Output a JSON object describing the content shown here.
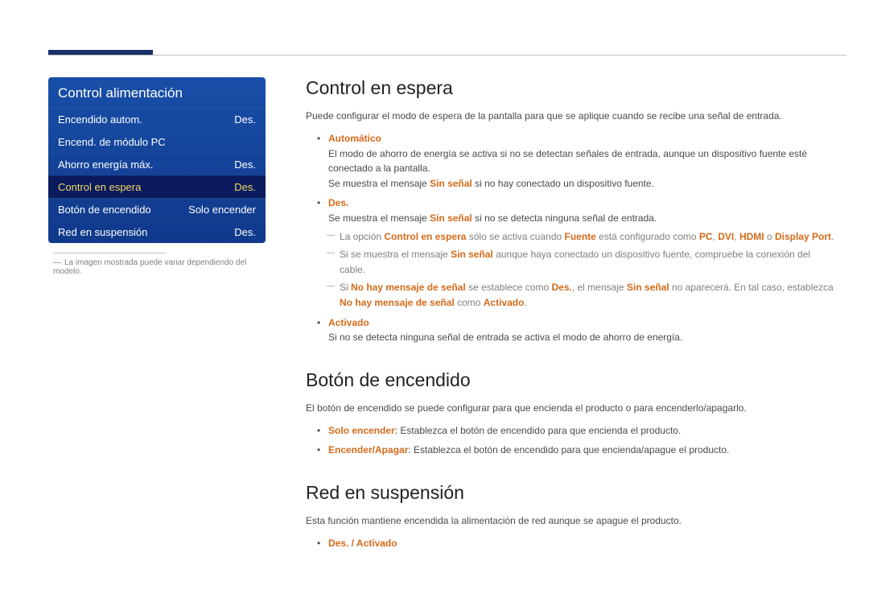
{
  "osd": {
    "title": "Control alimentación",
    "items": [
      {
        "label": "Encendido autom.",
        "value": "Des."
      },
      {
        "label": "Encend. de módulo PC",
        "value": ""
      },
      {
        "label": "Ahorro energía máx.",
        "value": "Des."
      },
      {
        "label": "Control en espera",
        "value": "Des.",
        "selected": true
      },
      {
        "label": "Botón de encendido",
        "value": "Solo encender"
      },
      {
        "label": "Red en suspensión",
        "value": "Des."
      }
    ]
  },
  "sidebar_note_dash": "―",
  "sidebar_note": "La imagen mostrada puede variar dependiendo del modelo.",
  "s1_h": "Control en espera",
  "s1_p": "Puede configurar el modo de espera de la pantalla para que se aplique cuando se recibe una señal de entrada.",
  "s1_b1_head": "Automático",
  "s1_b1_l1": "El modo de ahorro de energía se activa si no se detectan señales de entrada, aunque un dispositivo fuente esté conectado a la pantalla.",
  "s1_b1_l2_a": "Se muestra el mensaje ",
  "s1_b1_l2_hl": "Sin señal",
  "s1_b1_l2_b": " si no hay conectado un dispositivo fuente.",
  "s1_b2_head": "Des.",
  "s1_b2_l1_a": "Se muestra el mensaje ",
  "s1_b2_l1_hl": "Sin señal",
  "s1_b2_l1_b": " si no se detecta ninguna señal de entrada.",
  "s1_s1_a": "La opción ",
  "s1_s1_hl1": "Control en espera",
  "s1_s1_b": " sólo se activa cuando ",
  "s1_s1_hl2": "Fuente",
  "s1_s1_c": " está configurado como ",
  "s1_s1_hl3": "PC",
  "s1_s1_comma1": ", ",
  "s1_s1_hl4": "DVI",
  "s1_s1_comma2": ", ",
  "s1_s1_hl5": "HDMI",
  "s1_s1_d": " o ",
  "s1_s1_hl6": "Display Port",
  "s1_s1_e": ".",
  "s1_s2_a": "Si se muestra el mensaje ",
  "s1_s2_hl": "Sin señal",
  "s1_s2_b": " aunque haya conectado un dispositivo fuente, compruebe la conexión del cable.",
  "s1_s3_a": "Si ",
  "s1_s3_hl1": "No hay mensaje de señal",
  "s1_s3_b": " se establece como ",
  "s1_s3_hl2": "Des.",
  "s1_s3_c": ", el mensaje ",
  "s1_s3_hl3": "Sin señal",
  "s1_s3_d": " no aparecerá. En tal caso, establezca ",
  "s1_s3_hl4": "No hay mensaje de señal",
  "s1_s3_e": " como ",
  "s1_s3_hl5": "Activado",
  "s1_s3_f": ".",
  "s1_b4_head": "Activado",
  "s1_b4_l1": "Si no se detecta ninguna señal de entrada se activa el modo de ahorro de energía.",
  "s2_h": "Botón de encendido",
  "s2_p": "El botón de encendido se puede configurar para que encienda el producto o para encenderlo/apagarlo.",
  "s2_b1_hl": "Solo encender",
  "s2_b1_t": ": Establezca el botón de encendido para que encienda el producto.",
  "s2_b2_hl": "Encender/Apagar",
  "s2_b2_t": ": Establezca el botón de encendido para que encienda/apague el producto.",
  "s3_h": "Red en suspensión",
  "s3_p": "Esta función mantiene encendida la alimentación de red aunque se apague el producto.",
  "s3_opt": "Des. / Activado"
}
